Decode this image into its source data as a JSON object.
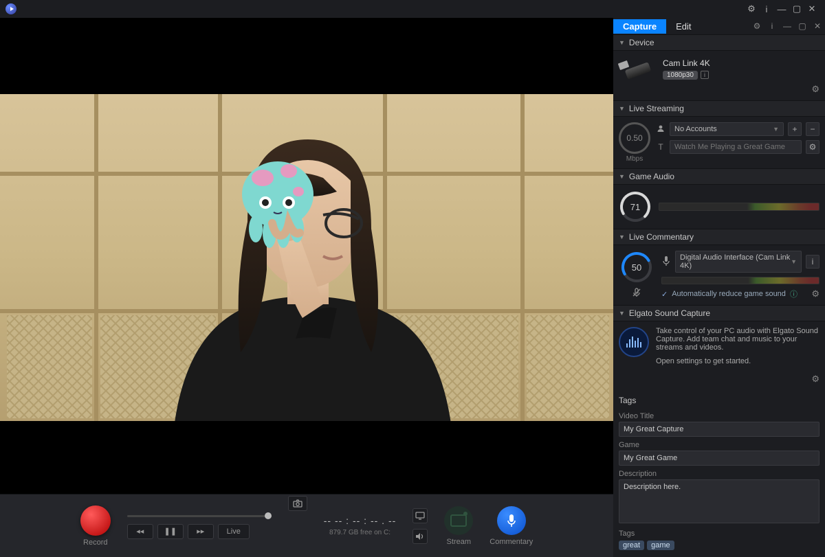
{
  "titlebar": {
    "gear": "⚙",
    "info": "i",
    "min": "—",
    "max": "▢",
    "close": "✕"
  },
  "tabs": {
    "capture": "Capture",
    "edit": "Edit"
  },
  "device": {
    "header": "Device",
    "name": "Cam Link 4K",
    "mode": "1080p30"
  },
  "live_streaming": {
    "header": "Live Streaming",
    "mbps": "0.50",
    "mbps_label": "Mbps",
    "accounts": "No Accounts",
    "title_placeholder": "Watch Me Playing a Great Game"
  },
  "game_audio": {
    "header": "Game Audio",
    "level": "71"
  },
  "live_commentary": {
    "header": "Live Commentary",
    "level": "50",
    "source": "Digital Audio Interface (Cam Link 4K)",
    "auto_reduce": "Automatically reduce game sound"
  },
  "sound_capture": {
    "header": "Elgato Sound Capture",
    "desc": "Take control of your PC audio with Elgato Sound Capture. Add team chat and music to your streams and videos.",
    "open": "Open settings to get started."
  },
  "tags": {
    "header": "Tags",
    "video_title_label": "Video Title",
    "video_title": "My Great Capture",
    "game_label": "Game",
    "game": "My Great Game",
    "description_label": "Description",
    "description": "Description here.",
    "tags_label": "Tags",
    "tags": [
      "great",
      "game"
    ]
  },
  "transport": {
    "record": "Record",
    "live": "Live",
    "timecode": "-- -- : -- : -- . --",
    "disk": "879.7 GB free on C:",
    "stream": "Stream",
    "commentary": "Commentary"
  }
}
